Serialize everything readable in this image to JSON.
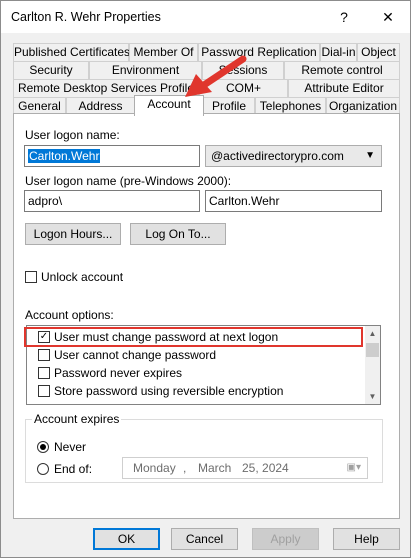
{
  "window": {
    "title": "Carlton R. Wehr Properties",
    "help_glyph": "?",
    "close_glyph": "✕"
  },
  "tabs": {
    "row1": [
      "Published Certificates",
      "Member Of",
      "Password Replication",
      "Dial-in",
      "Object"
    ],
    "row2": [
      "Security",
      "Environment",
      "Sessions",
      "Remote control"
    ],
    "row3": [
      "Remote Desktop Services Profile",
      "COM+",
      "Attribute Editor"
    ],
    "row4": [
      "General",
      "Address",
      "Account",
      "Profile",
      "Telephones",
      "Organization"
    ],
    "active": "Account"
  },
  "account": {
    "logon_name_label": "User logon name:",
    "logon_name_value": "Carlton.Wehr",
    "domain_value": "@activedirectorypro.com",
    "pre2000_label": "User logon name (pre-Windows 2000):",
    "pre2000_domain": "adpro\\",
    "pre2000_user": "Carlton.Wehr",
    "logon_hours_button": "Logon Hours...",
    "logon_to_button": "Log On To...",
    "unlock_label": "Unlock account",
    "options_label": "Account options:",
    "options": [
      {
        "label": "User must change password at next logon",
        "checked": true
      },
      {
        "label": "User cannot change password",
        "checked": false
      },
      {
        "label": "Password never expires",
        "checked": false
      },
      {
        "label": "Store password using reversible encryption",
        "checked": false
      }
    ],
    "expires_label": "Account expires",
    "never_label": "Never",
    "endof_label": "End of:",
    "expires_selected": "Never",
    "date": {
      "weekday": "Monday",
      "sep": ",",
      "month": "March",
      "day_year": "25, 2024"
    }
  },
  "footer": {
    "ok": "OK",
    "cancel": "Cancel",
    "apply": "Apply",
    "help": "Help"
  },
  "colors": {
    "accent": "#0078d7",
    "annotation": "#e0362d"
  }
}
